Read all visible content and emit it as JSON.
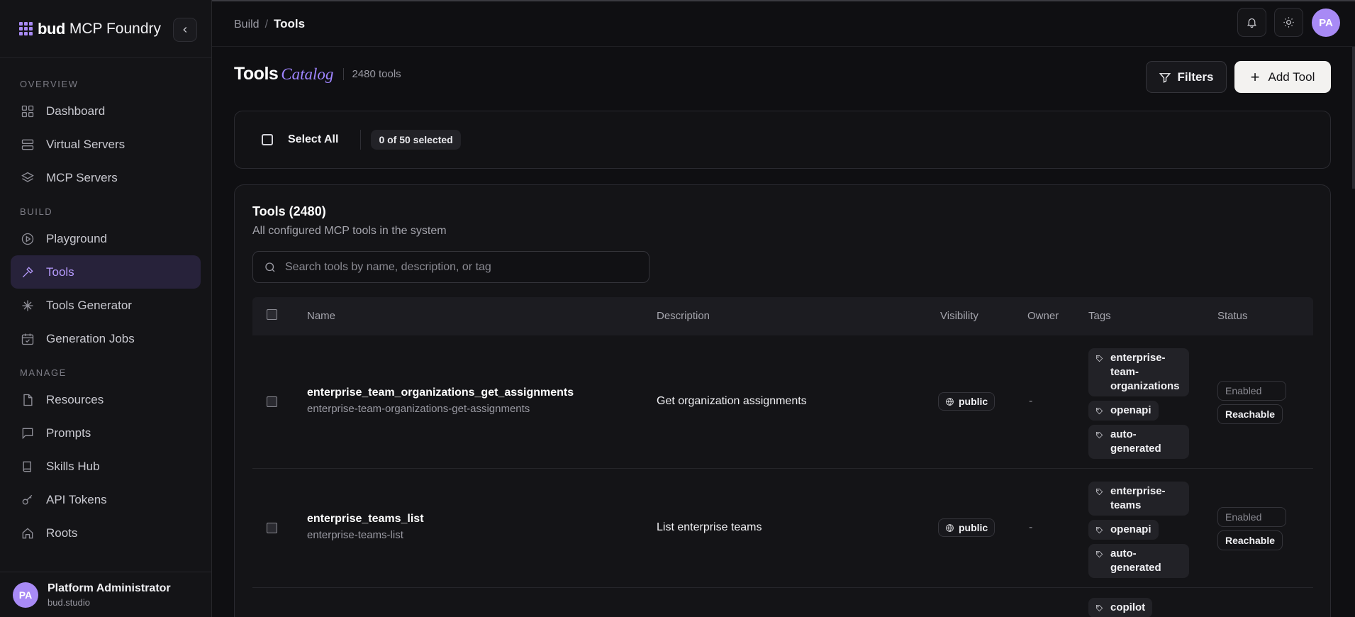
{
  "brand": {
    "name": "bud",
    "product": "MCP Foundry"
  },
  "sidebar": {
    "sections": [
      {
        "label": "OVERVIEW",
        "items": [
          {
            "label": "Dashboard",
            "icon": "dashboard-icon"
          },
          {
            "label": "Virtual Servers",
            "icon": "server-icon"
          },
          {
            "label": "MCP Servers",
            "icon": "layers-icon"
          }
        ]
      },
      {
        "label": "BUILD",
        "items": [
          {
            "label": "Playground",
            "icon": "play-icon"
          },
          {
            "label": "Tools",
            "icon": "wrench-icon",
            "active": true
          },
          {
            "label": "Tools Generator",
            "icon": "sparkle-icon"
          },
          {
            "label": "Generation Jobs",
            "icon": "calendar-check-icon"
          }
        ]
      },
      {
        "label": "MANAGE",
        "items": [
          {
            "label": "Resources",
            "icon": "file-icon"
          },
          {
            "label": "Prompts",
            "icon": "message-icon"
          },
          {
            "label": "Skills Hub",
            "icon": "book-icon"
          },
          {
            "label": "API Tokens",
            "icon": "key-icon"
          },
          {
            "label": "Roots",
            "icon": "home-icon"
          }
        ]
      }
    ],
    "user": {
      "initials": "PA",
      "name": "Platform Administrator",
      "org": "bud.studio"
    }
  },
  "topbar": {
    "breadcrumb": [
      "Build",
      "Tools"
    ],
    "avatar_initials": "PA"
  },
  "page": {
    "title": "Tools",
    "title_accent": "Catalog",
    "count_label": "2480 tools",
    "filters_label": "Filters",
    "add_label": "Add Tool"
  },
  "selection": {
    "select_all_label": "Select All",
    "selected_label": "0 of 50 selected"
  },
  "tools_card": {
    "title": "Tools (2480)",
    "subtitle": "All configured MCP tools in the system",
    "search_placeholder": "Search tools by name, description, or tag",
    "columns": [
      "Name",
      "Description",
      "Visibility",
      "Owner",
      "Tags",
      "Status"
    ],
    "rows": [
      {
        "name": "enterprise_team_organizations_get_assignments",
        "slug": "enterprise-team-organizations-get-assignments",
        "description": "Get organization assignments",
        "visibility": "public",
        "owner": "-",
        "tags": [
          "enterprise-team-organizations",
          "openapi",
          "auto-generated"
        ],
        "tag_lines": [
          [
            "enterprise-",
            "team-",
            "organizations"
          ],
          [
            "openapi"
          ],
          [
            "auto-",
            "generated"
          ]
        ],
        "status": "Enabled",
        "reachability": "Reachable"
      },
      {
        "name": "enterprise_teams_list",
        "slug": "enterprise-teams-list",
        "description": "List enterprise teams",
        "visibility": "public",
        "owner": "-",
        "tags": [
          "enterprise-teams",
          "openapi",
          "auto-generated"
        ],
        "tag_lines": [
          [
            "enterprise-",
            "teams"
          ],
          [
            "openapi"
          ],
          [
            "auto-",
            "generated"
          ]
        ],
        "status": "Enabled",
        "reachability": "Reachable"
      }
    ],
    "partial_row_tag": "copilot"
  }
}
